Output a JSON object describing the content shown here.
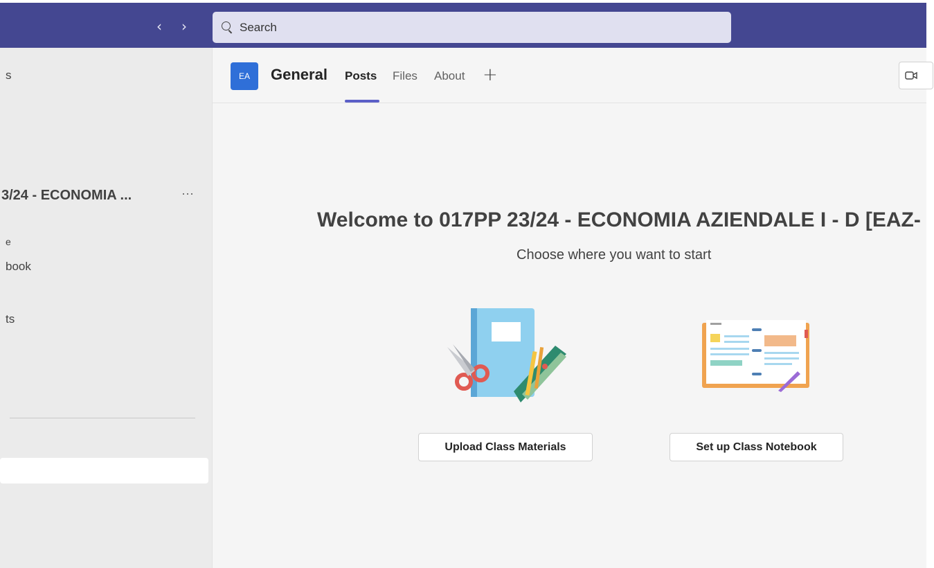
{
  "topbar": {
    "back_glyph": "‹",
    "forward_glyph": "›",
    "search_placeholder": "Search"
  },
  "sidebar": {
    "fragment_1": "s",
    "team_name": "3/24 - ECONOMIA ...",
    "team_more": "···",
    "fragment_2": "e",
    "fragment_3": "book",
    "fragment_4": "ts"
  },
  "channel": {
    "avatar": "EA",
    "name": "General",
    "tabs": [
      "Posts",
      "Files",
      "About"
    ],
    "active_tab": "Posts",
    "add_tab_glyph": "+"
  },
  "welcome": {
    "title": "Welcome to 017PP 23/24 - ECONOMIA AZIENDALE I - D [EAZ-",
    "subtitle": "Choose where you want to start"
  },
  "actions": {
    "upload_label": "Upload Class Materials",
    "notebook_label": "Set up Class Notebook"
  },
  "colors": {
    "topbar": "#444791",
    "accent": "#5b5fc7",
    "avatar": "#2f6fd8"
  },
  "icons": [
    "chevron-left-icon",
    "chevron-right-icon",
    "search-icon",
    "more-icon",
    "add-icon",
    "video-icon",
    "notebook-illustration",
    "class-notebook-illustration"
  ]
}
